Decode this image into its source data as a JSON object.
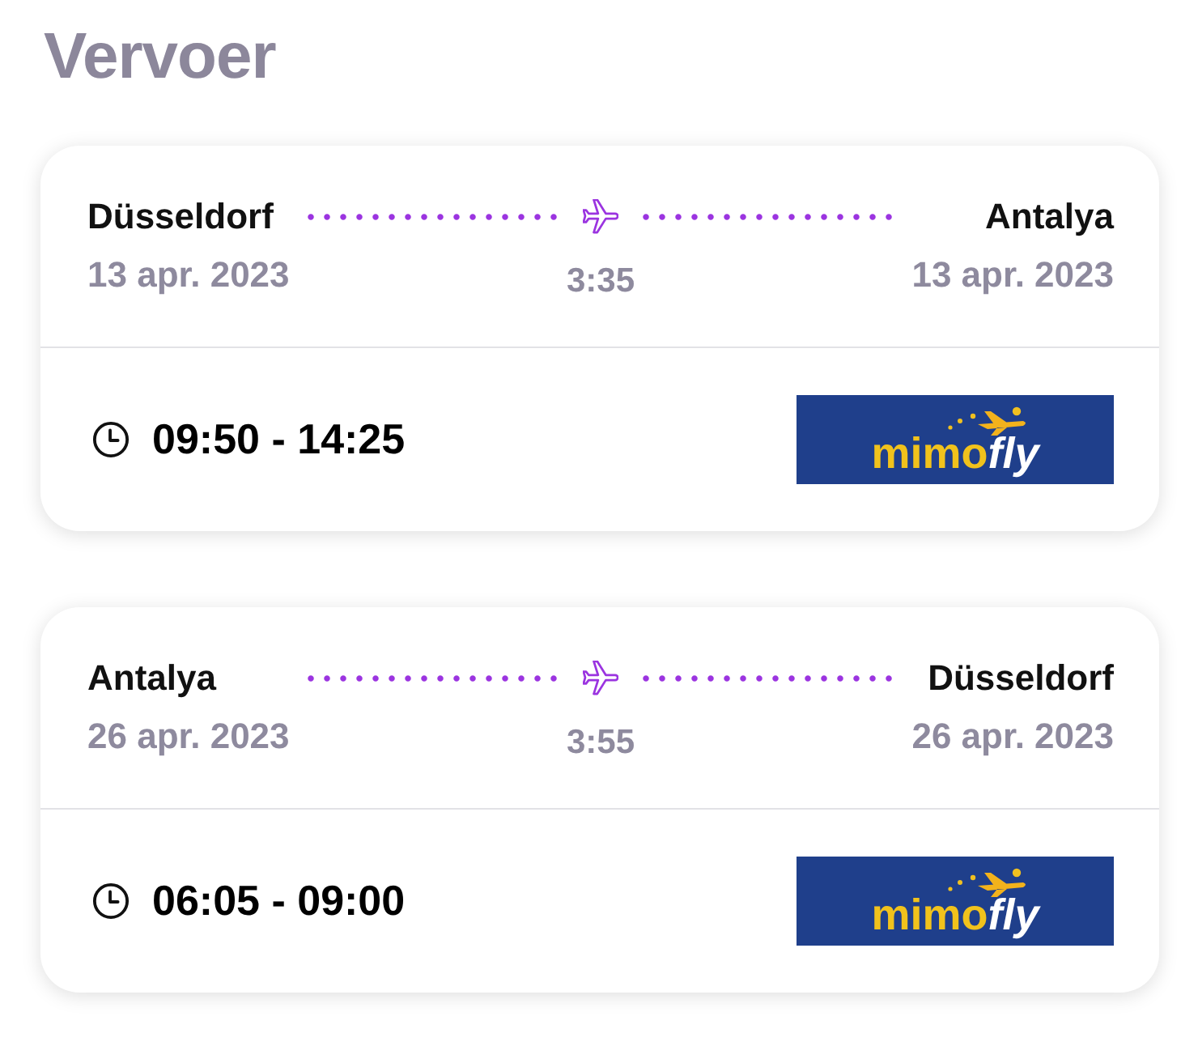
{
  "title": "Vervoer",
  "flights": [
    {
      "departure": {
        "city": "Düsseldorf",
        "date": "13 apr. 2023"
      },
      "arrival": {
        "city": "Antalya",
        "date": "13 apr. 2023"
      },
      "duration": "3:35",
      "time_range": "09:50 - 14:25",
      "airline_logo": [
        "mimo",
        "fly"
      ]
    },
    {
      "departure": {
        "city": "Antalya",
        "date": "26 apr. 2023"
      },
      "arrival": {
        "city": "Düsseldorf",
        "date": "26 apr. 2023"
      },
      "duration": "3:55",
      "time_range": "06:05 - 09:00",
      "airline_logo": [
        "mimo",
        "fly"
      ]
    }
  ]
}
